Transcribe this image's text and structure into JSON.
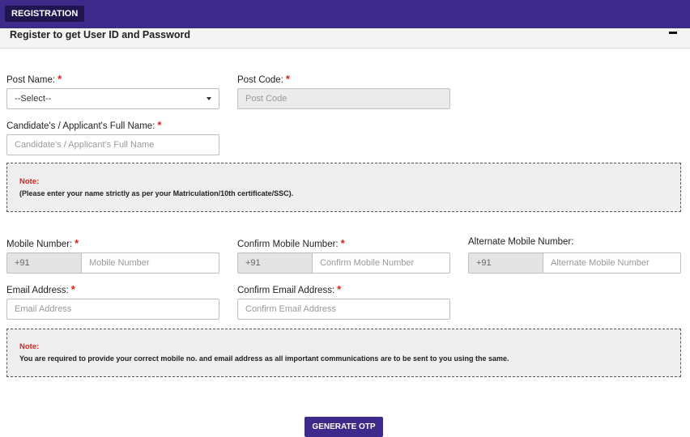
{
  "header": {
    "tab_label": "REGISTRATION"
  },
  "panel": {
    "title": "Register to get User ID and Password",
    "collapse_icon": "minus-icon"
  },
  "form": {
    "post_name": {
      "label": "Post Name:",
      "value": "--Select--"
    },
    "post_code": {
      "label": "Post Code:",
      "placeholder": "Post Code"
    },
    "full_name": {
      "label": "Candidate's / Applicant's Full Name:",
      "placeholder": "Candidate's / Applicant's Full Name"
    },
    "mobile": {
      "label": "Mobile Number:",
      "prefix": "+91",
      "placeholder": "Mobile Number"
    },
    "confirm_mobile": {
      "label": "Confirm Mobile Number:",
      "prefix": "+91",
      "placeholder": "Confirm Mobile Number"
    },
    "alt_mobile": {
      "label": "Alternate Mobile Number:",
      "prefix": "+91",
      "placeholder": "Alternate Mobile Number"
    },
    "email": {
      "label": "Email Address:",
      "placeholder": "Email Address"
    },
    "confirm_email": {
      "label": "Confirm Email Address:",
      "placeholder": "Confirm Email Address"
    },
    "required_mark": "*"
  },
  "notes": {
    "name_note": {
      "title": "Note:",
      "text": "(Please enter your name strictly as per your Matriculation/10th certificate/SSC)."
    },
    "contact_note": {
      "title": "Note:",
      "text": "You are required to provide your correct mobile no. and email address as all important communications are to be sent to you using the same."
    }
  },
  "actions": {
    "generate_otp": "GENERATE OTP"
  },
  "colors": {
    "header_bg": "#3d2a8a",
    "tab_bg": "#1f1650",
    "required": "#d9221c",
    "button_bg": "#3d2a8a"
  }
}
